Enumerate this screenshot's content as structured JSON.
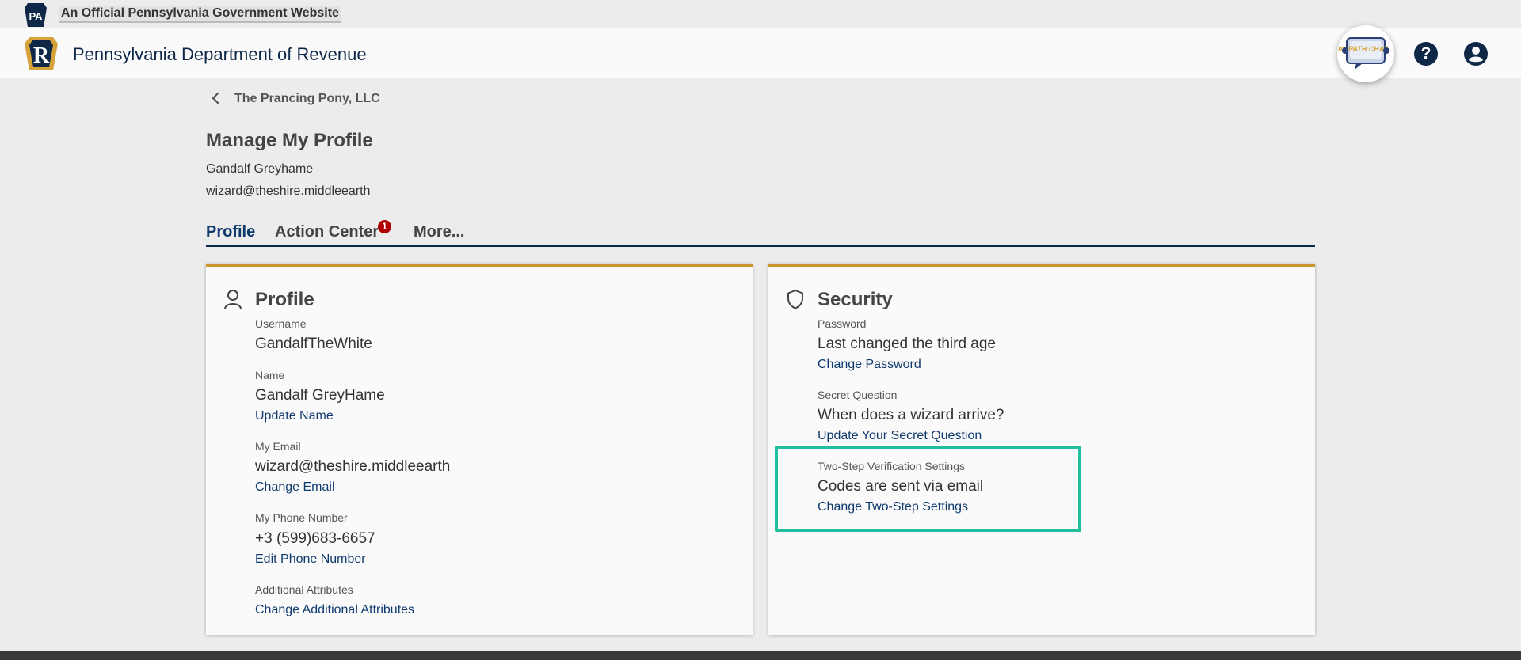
{
  "official_bar": {
    "badge_text": "PA",
    "text": "An Official Pennsylvania Government Website"
  },
  "header": {
    "logo_letter": "R",
    "title": "Pennsylvania Department of Revenue",
    "chat_label": "myPATH CHAT...",
    "help_glyph": "?"
  },
  "breadcrumb": {
    "label": "The Prancing Pony, LLC"
  },
  "page": {
    "title": "Manage My Profile",
    "user_name": "Gandalf Greyhame",
    "user_email": "wizard@theshire.middleearth"
  },
  "tabs": [
    {
      "label": "Profile",
      "active": true
    },
    {
      "label": "Action Center",
      "badge": "1"
    },
    {
      "label": "More..."
    }
  ],
  "profile_card": {
    "title": "Profile",
    "icon": "person-icon",
    "username_label": "Username",
    "username_value": "GandalfTheWhite",
    "name_label": "Name",
    "name_value": "Gandalf GreyHame",
    "name_link": "Update Name",
    "email_label": "My Email",
    "email_value": "wizard@theshire.middleearth",
    "email_link": "Change Email",
    "phone_label": "My Phone Number",
    "phone_value": "+3 (599)683-6657",
    "phone_link": "Edit Phone Number",
    "attributes_label": "Additional Attributes",
    "attributes_link": "Change Additional Attributes"
  },
  "security_card": {
    "title": "Security",
    "icon": "shield-icon",
    "password_label": "Password",
    "password_value": "Last changed the third age",
    "password_link": "Change Password",
    "question_label": "Secret Question",
    "question_value": "When does a wizard arrive?",
    "question_link": "Update Your Secret Question",
    "twostep_label": "Two-Step Verification Settings",
    "twostep_value": "Codes are sent via email",
    "twostep_link": "Change Two-Step Settings"
  },
  "colors": {
    "navy": "#0f2848",
    "link": "#0f3a6e",
    "card_accent": "#c9952f",
    "highlight": "#1fbfa0",
    "badge": "#b00000"
  }
}
